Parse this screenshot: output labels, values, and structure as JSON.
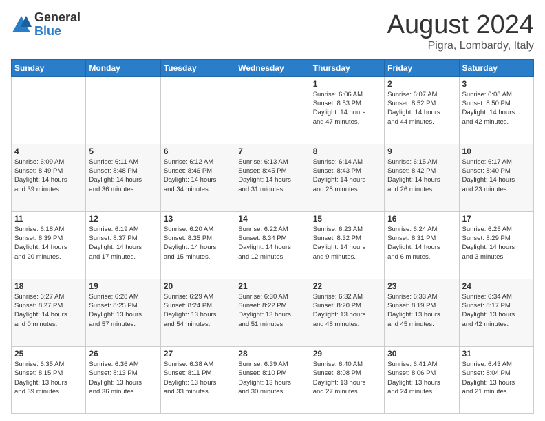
{
  "logo": {
    "general": "General",
    "blue": "Blue"
  },
  "title": "August 2024",
  "location": "Pigra, Lombardy, Italy",
  "days_header": [
    "Sunday",
    "Monday",
    "Tuesday",
    "Wednesday",
    "Thursday",
    "Friday",
    "Saturday"
  ],
  "weeks": [
    [
      {
        "day": "",
        "info": ""
      },
      {
        "day": "",
        "info": ""
      },
      {
        "day": "",
        "info": ""
      },
      {
        "day": "",
        "info": ""
      },
      {
        "day": "1",
        "info": "Sunrise: 6:06 AM\nSunset: 8:53 PM\nDaylight: 14 hours\nand 47 minutes."
      },
      {
        "day": "2",
        "info": "Sunrise: 6:07 AM\nSunset: 8:52 PM\nDaylight: 14 hours\nand 44 minutes."
      },
      {
        "day": "3",
        "info": "Sunrise: 6:08 AM\nSunset: 8:50 PM\nDaylight: 14 hours\nand 42 minutes."
      }
    ],
    [
      {
        "day": "4",
        "info": "Sunrise: 6:09 AM\nSunset: 8:49 PM\nDaylight: 14 hours\nand 39 minutes."
      },
      {
        "day": "5",
        "info": "Sunrise: 6:11 AM\nSunset: 8:48 PM\nDaylight: 14 hours\nand 36 minutes."
      },
      {
        "day": "6",
        "info": "Sunrise: 6:12 AM\nSunset: 8:46 PM\nDaylight: 14 hours\nand 34 minutes."
      },
      {
        "day": "7",
        "info": "Sunrise: 6:13 AM\nSunset: 8:45 PM\nDaylight: 14 hours\nand 31 minutes."
      },
      {
        "day": "8",
        "info": "Sunrise: 6:14 AM\nSunset: 8:43 PM\nDaylight: 14 hours\nand 28 minutes."
      },
      {
        "day": "9",
        "info": "Sunrise: 6:15 AM\nSunset: 8:42 PM\nDaylight: 14 hours\nand 26 minutes."
      },
      {
        "day": "10",
        "info": "Sunrise: 6:17 AM\nSunset: 8:40 PM\nDaylight: 14 hours\nand 23 minutes."
      }
    ],
    [
      {
        "day": "11",
        "info": "Sunrise: 6:18 AM\nSunset: 8:39 PM\nDaylight: 14 hours\nand 20 minutes."
      },
      {
        "day": "12",
        "info": "Sunrise: 6:19 AM\nSunset: 8:37 PM\nDaylight: 14 hours\nand 17 minutes."
      },
      {
        "day": "13",
        "info": "Sunrise: 6:20 AM\nSunset: 8:35 PM\nDaylight: 14 hours\nand 15 minutes."
      },
      {
        "day": "14",
        "info": "Sunrise: 6:22 AM\nSunset: 8:34 PM\nDaylight: 14 hours\nand 12 minutes."
      },
      {
        "day": "15",
        "info": "Sunrise: 6:23 AM\nSunset: 8:32 PM\nDaylight: 14 hours\nand 9 minutes."
      },
      {
        "day": "16",
        "info": "Sunrise: 6:24 AM\nSunset: 8:31 PM\nDaylight: 14 hours\nand 6 minutes."
      },
      {
        "day": "17",
        "info": "Sunrise: 6:25 AM\nSunset: 8:29 PM\nDaylight: 14 hours\nand 3 minutes."
      }
    ],
    [
      {
        "day": "18",
        "info": "Sunrise: 6:27 AM\nSunset: 8:27 PM\nDaylight: 14 hours\nand 0 minutes."
      },
      {
        "day": "19",
        "info": "Sunrise: 6:28 AM\nSunset: 8:25 PM\nDaylight: 13 hours\nand 57 minutes."
      },
      {
        "day": "20",
        "info": "Sunrise: 6:29 AM\nSunset: 8:24 PM\nDaylight: 13 hours\nand 54 minutes."
      },
      {
        "day": "21",
        "info": "Sunrise: 6:30 AM\nSunset: 8:22 PM\nDaylight: 13 hours\nand 51 minutes."
      },
      {
        "day": "22",
        "info": "Sunrise: 6:32 AM\nSunset: 8:20 PM\nDaylight: 13 hours\nand 48 minutes."
      },
      {
        "day": "23",
        "info": "Sunrise: 6:33 AM\nSunset: 8:19 PM\nDaylight: 13 hours\nand 45 minutes."
      },
      {
        "day": "24",
        "info": "Sunrise: 6:34 AM\nSunset: 8:17 PM\nDaylight: 13 hours\nand 42 minutes."
      }
    ],
    [
      {
        "day": "25",
        "info": "Sunrise: 6:35 AM\nSunset: 8:15 PM\nDaylight: 13 hours\nand 39 minutes."
      },
      {
        "day": "26",
        "info": "Sunrise: 6:36 AM\nSunset: 8:13 PM\nDaylight: 13 hours\nand 36 minutes."
      },
      {
        "day": "27",
        "info": "Sunrise: 6:38 AM\nSunset: 8:11 PM\nDaylight: 13 hours\nand 33 minutes."
      },
      {
        "day": "28",
        "info": "Sunrise: 6:39 AM\nSunset: 8:10 PM\nDaylight: 13 hours\nand 30 minutes."
      },
      {
        "day": "29",
        "info": "Sunrise: 6:40 AM\nSunset: 8:08 PM\nDaylight: 13 hours\nand 27 minutes."
      },
      {
        "day": "30",
        "info": "Sunrise: 6:41 AM\nSunset: 8:06 PM\nDaylight: 13 hours\nand 24 minutes."
      },
      {
        "day": "31",
        "info": "Sunrise: 6:43 AM\nSunset: 8:04 PM\nDaylight: 13 hours\nand 21 minutes."
      }
    ]
  ]
}
